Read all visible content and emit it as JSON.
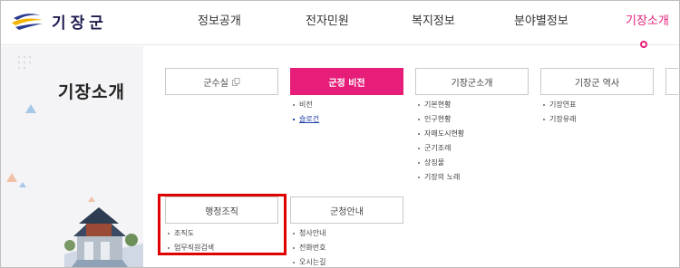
{
  "logo": {
    "text": "기장군"
  },
  "nav": [
    {
      "label": "정보공개",
      "active": false
    },
    {
      "label": "전자민원",
      "active": false
    },
    {
      "label": "복지정보",
      "active": false
    },
    {
      "label": "분야별정보",
      "active": false
    },
    {
      "label": "기장소개",
      "active": true
    }
  ],
  "left": {
    "title": "기장소개"
  },
  "cards": [
    {
      "label": "군수실",
      "icon": "link-icon",
      "items": []
    },
    {
      "label": "군정 비전",
      "active": true,
      "items": [
        "비전",
        "슬로건"
      ]
    },
    {
      "label": "기장군소개",
      "items": [
        "기본현황",
        "인구현황",
        "자매도시현황",
        "군기조례",
        "상징물",
        "기장의 노래"
      ]
    },
    {
      "label": "기장군 역사",
      "items": [
        "기장연표",
        "기장유래"
      ]
    },
    {
      "label": "행정조직",
      "items": [
        "조직도",
        "업무직원검색"
      ]
    },
    {
      "label": "군청안내",
      "items": [
        "청사안내",
        "전화번호",
        "오시는길"
      ]
    }
  ],
  "colors": {
    "accent": "#e61e79",
    "highlight": "#e00000",
    "link": "#2141a8"
  }
}
